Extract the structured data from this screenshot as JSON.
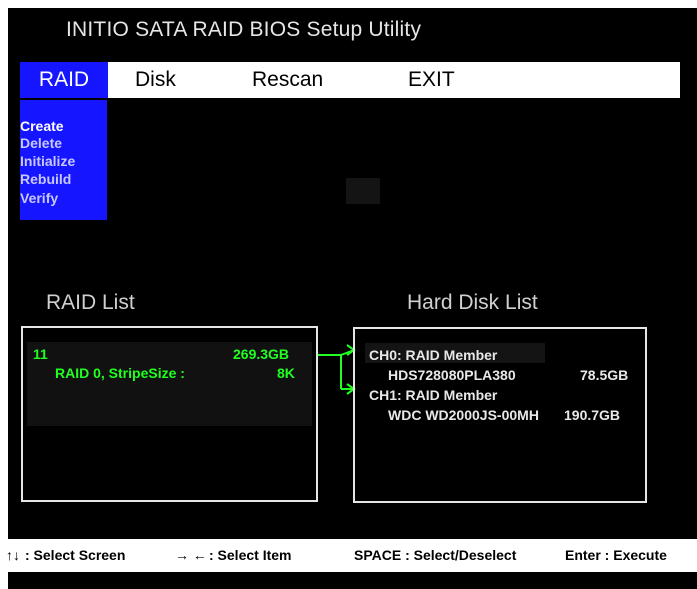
{
  "title": "INITIO SATA RAID BIOS Setup Utility",
  "menu": {
    "raid": "RAID",
    "disk": "Disk",
    "rescan": "Rescan",
    "exit": "EXIT"
  },
  "submenu": [
    "Create",
    "Delete",
    "Initialize",
    "Rebuild",
    "Verify"
  ],
  "raid_list": {
    "title": "RAID List",
    "id": "11",
    "size": "269.3GB",
    "desc": "RAID 0, StripeSize :",
    "stripe": "8K"
  },
  "disk_list": {
    "title": "Hard Disk List",
    "disks": [
      {
        "channel": "CH0:  RAID Member",
        "model": "HDS728080PLA380",
        "size": "78.5GB"
      },
      {
        "channel": "CH1:  RAID Member",
        "model": "WDC WD2000JS-00MH",
        "size": "190.7GB"
      }
    ]
  },
  "footer": {
    "arrows_ud": "↑↓",
    "select_screen": ": Select Screen",
    "arrows_lr": "→ ←",
    "select_item": ": Select Item",
    "space": "SPACE : Select/Deselect",
    "enter": "Enter : Execute"
  },
  "colors": {
    "menu_highlight": "#1515ff",
    "raid_text": "#20ff20",
    "background": "#000000"
  }
}
